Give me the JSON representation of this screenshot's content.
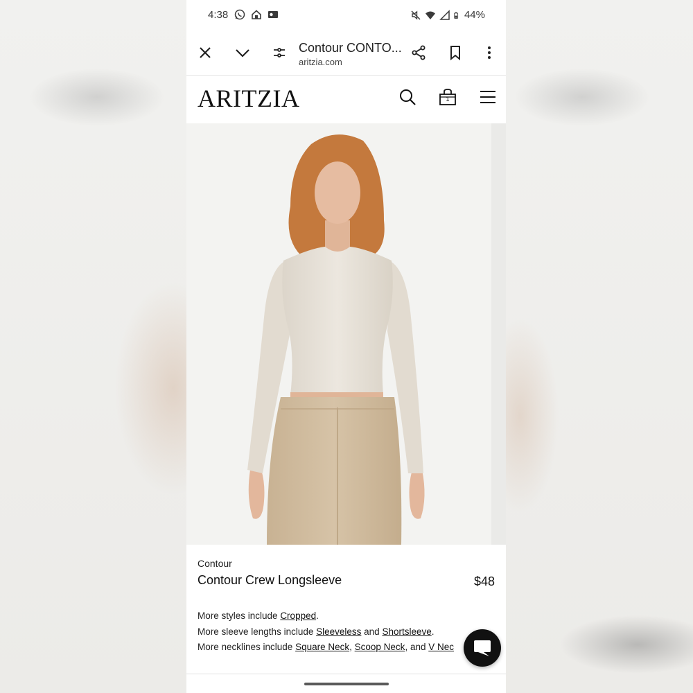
{
  "status_bar": {
    "time": "4:38",
    "left_icons": [
      "whatsapp-icon",
      "home-icon",
      "outlook-icon"
    ],
    "right_icons": [
      "mute-icon",
      "wifi-icon",
      "signal-icon",
      "battery-icon"
    ],
    "battery": "44%"
  },
  "browser": {
    "tab_title": "Contour CONTO...",
    "url": "aritzia.com",
    "buttons": [
      "close-icon",
      "chevron-down-icon",
      "tune-icon",
      "share-icon",
      "bookmark-icon",
      "more-vert-icon"
    ]
  },
  "site": {
    "logo": "ARITZIA",
    "bag_count": "1"
  },
  "product": {
    "brand": "Contour",
    "name": "Contour Crew Longsleeve",
    "price": "$48"
  },
  "more_styles": {
    "line1_prefix": "More styles include ",
    "cropped": "Cropped",
    "period": ".",
    "line2_prefix": "More sleeve lengths include ",
    "sleeveless": "Sleeveless",
    "and": " and ",
    "shortsleeve": "Shortsleeve",
    "line3_prefix": "More necklines include ",
    "square_neck": "Square Neck",
    "comma": ", ",
    "scoop_neck": "Scoop Neck",
    "and2": ", and ",
    "v_neck": "V Nec"
  },
  "colors": {
    "top": "#e9e3da",
    "pants": "#d4c0a3",
    "hair": "#c47a3f",
    "skin": "#e3b79c",
    "chat_button": "#111111"
  }
}
